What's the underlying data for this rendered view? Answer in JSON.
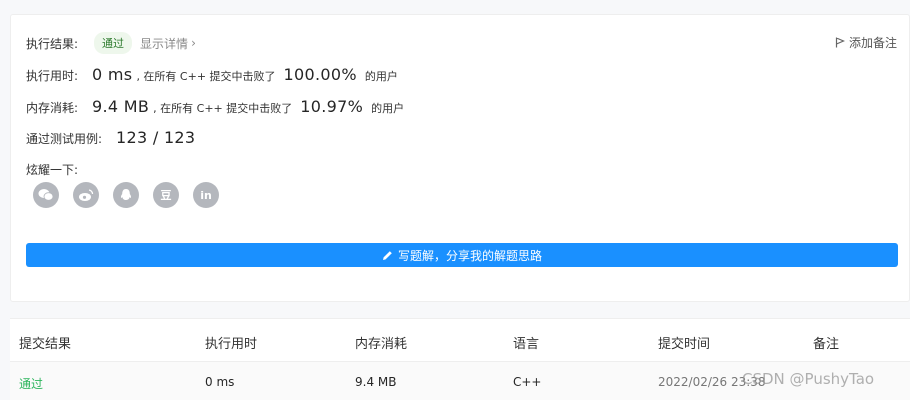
{
  "result": {
    "label": "执行结果:",
    "status": "通过",
    "detail_link": "显示详情",
    "note_button": "添加备注"
  },
  "runtime": {
    "label": "执行用时:",
    "value": "0 ms",
    "prefix": ", 在所有 C++ 提交中击败了",
    "percent": "100.00%",
    "suffix": "的用户"
  },
  "memory": {
    "label": "内存消耗:",
    "value": "9.4 MB",
    "prefix": ", 在所有 C++ 提交中击败了",
    "percent": "10.97%",
    "suffix": "的用户"
  },
  "testcases": {
    "label": "通过测试用例:",
    "value": "123 / 123"
  },
  "share": {
    "label": "炫耀一下:",
    "icons": [
      "wechat-icon",
      "weibo-icon",
      "qq-icon",
      "douban-icon",
      "linkedin-icon"
    ],
    "douban_glyph": "豆",
    "linkedin_glyph": "in"
  },
  "solution_button": "写题解，分享我的解题思路",
  "table": {
    "headers": [
      "提交结果",
      "执行用时",
      "内存消耗",
      "语言",
      "提交时间",
      "备注"
    ],
    "rows": [
      [
        "通过",
        "0 ms",
        "9.4 MB",
        "C++",
        "2022/02/26 23:38",
        ""
      ]
    ]
  },
  "watermark": "CSDN @PushyTao",
  "colors": {
    "accent": "#1a90ff",
    "pass": "#2db55d",
    "icon_gray": "#b4b7bd"
  }
}
